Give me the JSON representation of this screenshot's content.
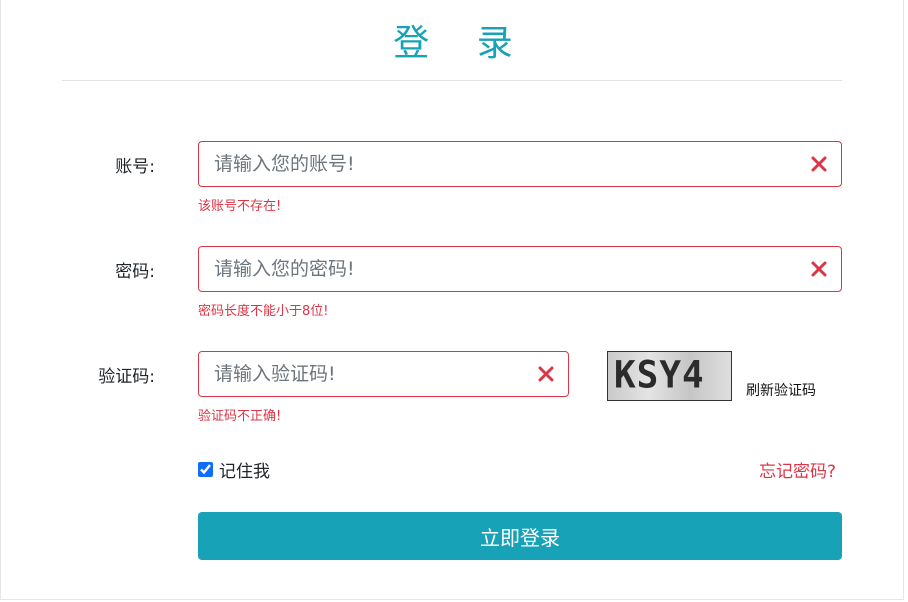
{
  "title": "登 录",
  "form": {
    "account": {
      "label": "账号:",
      "placeholder": "请输入您的账号!",
      "value": "",
      "error": "该账号不存在!"
    },
    "password": {
      "label": "密码:",
      "placeholder": "请输入您的密码!",
      "value": "",
      "error": "密码长度不能小于8位!"
    },
    "captcha": {
      "label": "验证码:",
      "placeholder": "请输入验证码!",
      "value": "",
      "error": "验证码不正确!",
      "image_text": "KSY4",
      "refresh_label": "刷新验证码"
    },
    "remember": {
      "label": "记住我",
      "checked": true
    },
    "forgot_label": "忘记密码?",
    "submit_label": "立即登录"
  },
  "colors": {
    "accent": "#17a2b8",
    "error": "#dc3545"
  },
  "icons": {
    "clear": "close-x-icon"
  }
}
